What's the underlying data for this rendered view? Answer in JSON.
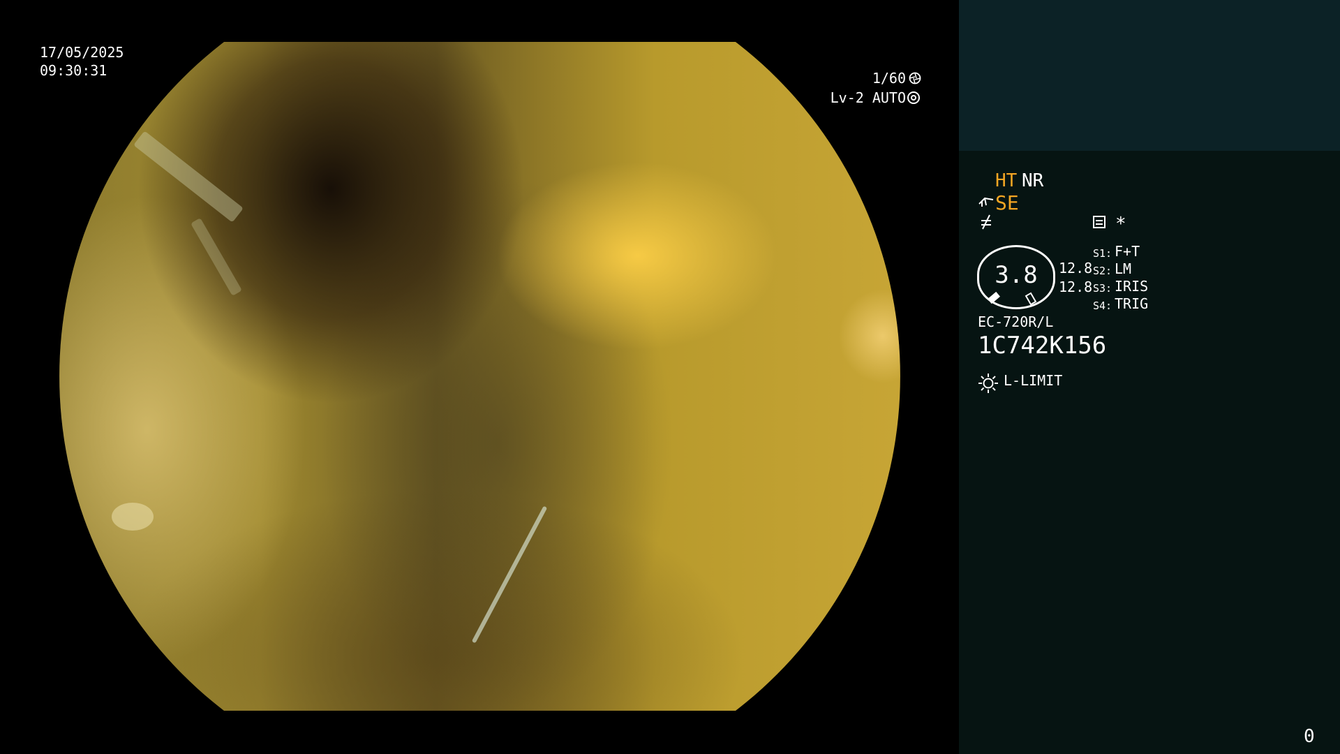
{
  "overlay": {
    "date": "17/05/2025",
    "time": "09:30:31",
    "shutter": "1/60",
    "level": "Lv-2 AUTO",
    "shutter_icon": "aperture-icon",
    "level_icon": "ring-icon"
  },
  "panel": {
    "ht": "HT",
    "nr": "NR",
    "se": "SE",
    "se_icon": "hand-icon",
    "edge_icon": "edge-icon",
    "preset_icon": "preset-icon",
    "star": "*",
    "gauge_value": "3.8",
    "value_1": "12.8",
    "value_2": "12.8",
    "switches": [
      {
        "label": "S1:",
        "value": "F+T"
      },
      {
        "label": "S2:",
        "value": "LM"
      },
      {
        "label": "S3:",
        "value": "IRIS"
      },
      {
        "label": "S4:",
        "value": "TRIG"
      }
    ],
    "model": "EC-720R/L",
    "serial": "1C742K156",
    "light_icon": "sun-icon",
    "light_status": "L-LIMIT",
    "counter": "0"
  },
  "colors": {
    "panel_top": "#0c2226",
    "panel": "#061412",
    "accent": "#f5a623",
    "text": "#ffffff"
  }
}
